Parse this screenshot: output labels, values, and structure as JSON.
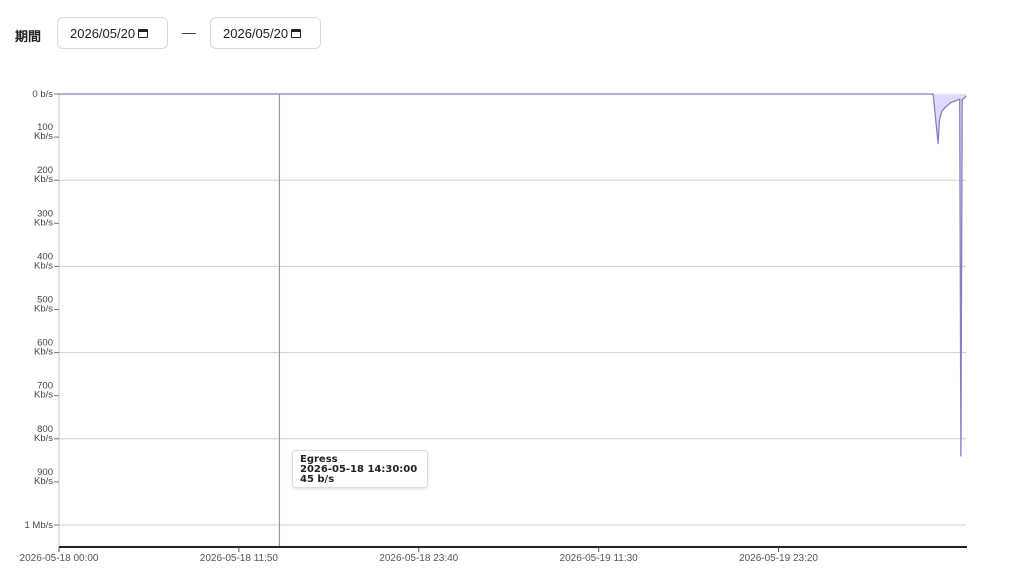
{
  "filter": {
    "label": "期間",
    "start_date": "2026/05/20",
    "end_date": "2026/05/20",
    "separator": "—"
  },
  "chart_data": {
    "type": "area",
    "y_axis": {
      "reversed": true,
      "range_bps": [
        0,
        1000000
      ],
      "ticks": [
        {
          "value": 0,
          "label": [
            "0 b/s"
          ]
        },
        {
          "value": 100000,
          "label": [
            "100",
            "Kb/s"
          ]
        },
        {
          "value": 200000,
          "label": [
            "200",
            "Kb/s"
          ]
        },
        {
          "value": 300000,
          "label": [
            "300",
            "Kb/s"
          ]
        },
        {
          "value": 400000,
          "label": [
            "400",
            "Kb/s"
          ]
        },
        {
          "value": 500000,
          "label": [
            "500",
            "Kb/s"
          ]
        },
        {
          "value": 600000,
          "label": [
            "600",
            "Kb/s"
          ]
        },
        {
          "value": 700000,
          "label": [
            "700",
            "Kb/s"
          ]
        },
        {
          "value": 800000,
          "label": [
            "800",
            "Kb/s"
          ]
        },
        {
          "value": 900000,
          "label": [
            "900",
            "Kb/s"
          ]
        },
        {
          "value": 1000000,
          "label": [
            "1 Mb/s"
          ]
        }
      ]
    },
    "x_axis": {
      "range": [
        "2026-05-18T00:00",
        "2026-05-20T11:40"
      ],
      "ticks": [
        {
          "value": "2026-05-18T00:00",
          "label": "2026-05-18 00:00"
        },
        {
          "value": "2026-05-18T11:50",
          "label": "2026-05-18 11:50"
        },
        {
          "value": "2026-05-18T23:40",
          "label": "2026-05-18 23:40"
        },
        {
          "value": "2026-05-19T11:30",
          "label": "2026-05-19 11:30"
        },
        {
          "value": "2026-05-19T23:20",
          "label": "2026-05-19 23:20"
        }
      ]
    },
    "grid": true,
    "series": [
      {
        "color": "#8e7cc3",
        "fill": "#dcdcfa",
        "points": [
          {
            "t": "2026-05-18T00:00",
            "v": 0
          },
          {
            "t": "2026-05-18T14:30",
            "v": 45
          },
          {
            "t": "2026-05-20T09:30",
            "v": 0
          },
          {
            "t": "2026-05-20T09:50",
            "v": 115000
          },
          {
            "t": "2026-05-20T09:55",
            "v": 60000
          },
          {
            "t": "2026-05-20T10:05",
            "v": 40000
          },
          {
            "t": "2026-05-20T10:20",
            "v": 30000
          },
          {
            "t": "2026-05-20T10:40",
            "v": 20000
          },
          {
            "t": "2026-05-20T11:15",
            "v": 12000
          },
          {
            "t": "2026-05-20T11:20",
            "v": 840000
          },
          {
            "t": "2026-05-20T11:25",
            "v": 14000
          },
          {
            "t": "2026-05-20T11:40",
            "v": 5000
          }
        ]
      }
    ],
    "crosshair": {
      "t": "2026-05-18T14:30"
    },
    "tooltip": {
      "series": "Egress",
      "time": "2026-05-18 14:30:00",
      "value": "45 b/s"
    }
  }
}
